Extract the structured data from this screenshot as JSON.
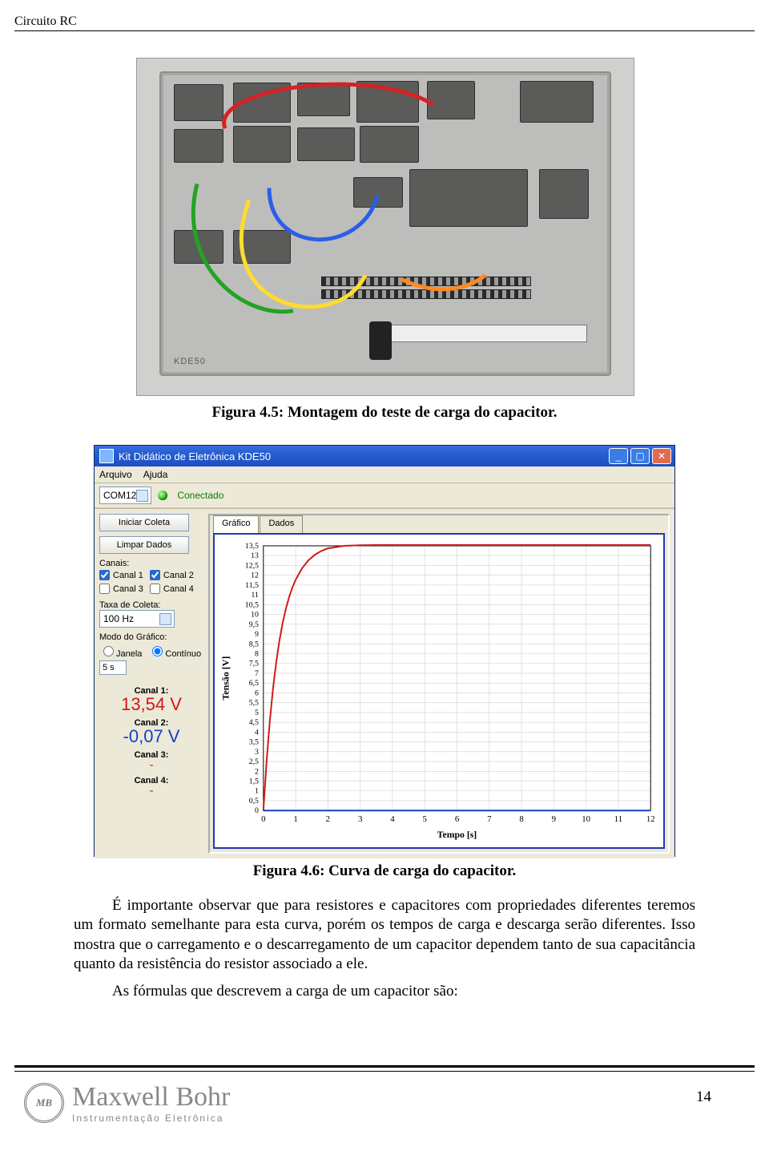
{
  "page": {
    "running_head": "Circuito RC",
    "number": "14"
  },
  "figure_top": {
    "board_label": "KDE50",
    "caption": "Figura 4.5: Montagem do teste de carga do capacitor."
  },
  "app": {
    "title": "Kit Didático de Eletrônica KDE50",
    "menu": {
      "file": "Arquivo",
      "help": "Ajuda"
    },
    "port": {
      "value": "COM12"
    },
    "status": "Conectado",
    "tabs": {
      "grafico": "Gráfico",
      "dados": "Dados"
    },
    "side": {
      "iniciar": "Iniciar Coleta",
      "limpar": "Limpar Dados",
      "canais_title": "Canais:",
      "ck1": "Canal 1",
      "ck2": "Canal 2",
      "ck3": "Canal 3",
      "ck4": "Canal 4",
      "taxa_title": "Taxa de Coleta:",
      "taxa_value": "100 Hz",
      "modo_title": "Modo do Gráfico:",
      "modo_janela": "Janela",
      "modo_continuo": "Contínuo",
      "janela_input": "5 s",
      "ch1_label": "Canal 1:",
      "ch1_value": "13,54 V",
      "ch2_label": "Canal 2:",
      "ch2_value": "-0,07 V",
      "ch3_label": "Canal 3:",
      "ch3_value": "-",
      "ch4_label": "Canal 4:",
      "ch4_value": "-"
    },
    "axes": {
      "y": "Tensão [V]",
      "x": "Tempo [s]"
    }
  },
  "figure_bottom": {
    "caption": "Figura 4.6: Curva de carga do capacitor."
  },
  "body": {
    "p1": "É importante observar que para resistores e capacitores com propriedades diferentes teremos um formato semelhante para esta curva, porém os tempos de carga e descarga serão diferentes. Isso mostra que o carregamento e o descarregamento de um capacitor dependem tanto de sua capacitância quanto da resistência do resistor associado a ele.",
    "p2": "As fórmulas que descrevem a carga de um capacitor são:"
  },
  "footer": {
    "badge": "MB",
    "brand": "Maxwell Bohr",
    "tagline": "Instrumentação Eletrônica"
  },
  "chart_data": {
    "type": "line",
    "title": "",
    "xlabel": "Tempo [s]",
    "ylabel": "Tensão [V]",
    "xlim": [
      0,
      12
    ],
    "ylim": [
      0,
      13.5
    ],
    "x_ticks": [
      0,
      1,
      2,
      3,
      4,
      5,
      6,
      7,
      8,
      9,
      10,
      11,
      12
    ],
    "y_ticks": [
      0,
      0.5,
      1,
      1.5,
      2,
      2.5,
      3,
      3.5,
      4,
      4.5,
      5,
      5.5,
      6,
      6.5,
      7,
      7.5,
      8,
      8.5,
      9,
      9.5,
      10,
      10.5,
      11,
      11.5,
      12,
      12.5,
      13,
      13.5
    ],
    "series": [
      {
        "name": "Canal 1",
        "color": "#d11717",
        "x": [
          0.0,
          0.1,
          0.2,
          0.3,
          0.4,
          0.5,
          0.6,
          0.7,
          0.8,
          0.9,
          1.0,
          1.2,
          1.4,
          1.6,
          1.8,
          2.0,
          2.5,
          3.0,
          3.5,
          4.0,
          5.0,
          6.0,
          8.0,
          10.0,
          12.0
        ],
        "values": [
          0.0,
          2.52,
          4.57,
          6.24,
          7.59,
          8.69,
          9.59,
          10.31,
          10.9,
          11.38,
          11.77,
          12.36,
          12.77,
          13.05,
          13.24,
          13.37,
          13.5,
          13.53,
          13.54,
          13.54,
          13.54,
          13.54,
          13.54,
          13.54,
          13.54
        ]
      },
      {
        "name": "Canal 2",
        "color": "#1340c9",
        "x": [
          0,
          12
        ],
        "values": [
          -0.07,
          -0.07
        ]
      }
    ]
  }
}
